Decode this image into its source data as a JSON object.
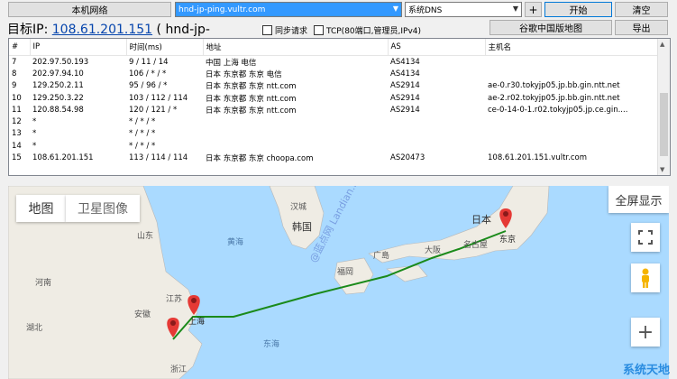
{
  "toolbar": {
    "local_network": "本机网络",
    "host_input": "hnd-jp-ping.vultr.com",
    "dns_select": "系统DNS",
    "add_label": "+",
    "start_label": "开始",
    "clear_label": "清空",
    "google_map_label": "谷歌中国版地图",
    "export_label": "导出"
  },
  "target": {
    "prefix": "目标IP: ",
    "ip": "108.61.201.151",
    "suffix": " ( hnd-jp-"
  },
  "options": {
    "sync": "同步请求",
    "tcp": "TCP(80端口,管理员,IPv4)"
  },
  "table": {
    "headers": [
      "#",
      "IP",
      "时间(ms)",
      "地址",
      "AS",
      "主机名"
    ],
    "rows": [
      [
        "7",
        "202.97.50.193",
        "9 / 11 / 14",
        "中国 上海 电信",
        "AS4134",
        ""
      ],
      [
        "8",
        "202.97.94.10",
        "106 / * / *",
        "日本 东京都 东京 电信",
        "AS4134",
        ""
      ],
      [
        "9",
        "129.250.2.11",
        "95 / 96 / *",
        "日本 东京都 东京 ntt.com",
        "AS2914",
        "ae-0.r30.tokyjp05.jp.bb.gin.ntt.net"
      ],
      [
        "10",
        "129.250.3.22",
        "103 / 112 / 114",
        "日本 东京都 东京 ntt.com",
        "AS2914",
        "ae-2.r02.tokyjp05.jp.bb.gin.ntt.net"
      ],
      [
        "11",
        "120.88.54.98",
        "120 / 121 / *",
        "日本 东京都 东京 ntt.com",
        "AS2914",
        "ce-0-14-0-1.r02.tokyjp05.jp.ce.gin...."
      ],
      [
        "12",
        "*",
        "* / * / *",
        "",
        "",
        ""
      ],
      [
        "13",
        "*",
        "* / * / *",
        "",
        "",
        ""
      ],
      [
        "14",
        "*",
        "* / * / *",
        "",
        "",
        ""
      ],
      [
        "15",
        "108.61.201.151",
        "113 / 114 / 114",
        "日本 东京都 东京 choopa.com",
        "AS20473",
        "108.61.201.151.vultr.com"
      ]
    ]
  },
  "map": {
    "tab_map": "地图",
    "tab_satellite": "卫星图像",
    "fullscreen": "全屏显示",
    "labels": {
      "shandong": "山东",
      "jiangsu": "江苏",
      "henan": "河南",
      "hubei": "湖北",
      "anhui": "安徽",
      "zhejiang": "浙江",
      "shanghai": "上海",
      "yellow_sea": "黄海",
      "east_sea": "东海",
      "korea_n": "汉城",
      "korea": "韩国",
      "japan": "日本",
      "tokyo": "东京",
      "hiroshima": "广島",
      "fukuoka": "福岡",
      "osaka": "大阪",
      "nagoya": "名古屋",
      "beijing_area": "山"
    },
    "watermark1": "@蓝点网 Landian.News",
    "watermark2": "系统天地",
    "route_color": "#1a8a1a",
    "marker_color": "#e53935"
  }
}
